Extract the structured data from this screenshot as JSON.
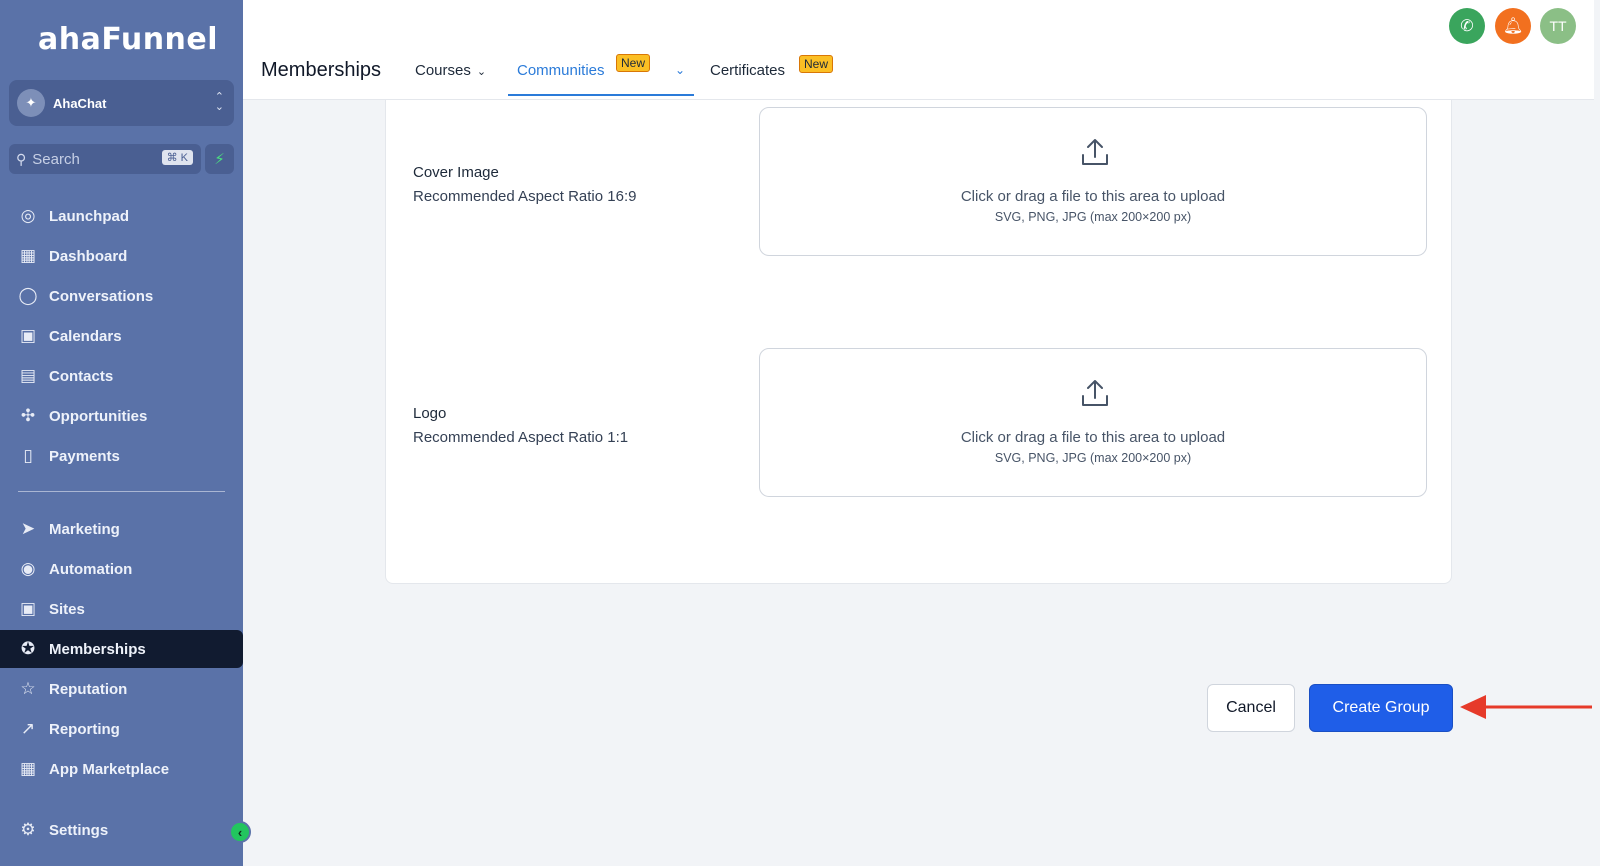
{
  "brand": {
    "logo_text": "ahaFunnel"
  },
  "account": {
    "name": "AhaChat"
  },
  "search": {
    "placeholder": "Search",
    "shortcut": "⌘ K"
  },
  "sidebar": {
    "items": [
      {
        "label": "Launchpad",
        "icon": "rocket-icon"
      },
      {
        "label": "Dashboard",
        "icon": "grid-icon"
      },
      {
        "label": "Conversations",
        "icon": "chat-icon"
      },
      {
        "label": "Calendars",
        "icon": "calendar-icon"
      },
      {
        "label": "Contacts",
        "icon": "contacts-icon"
      },
      {
        "label": "Opportunities",
        "icon": "network-icon"
      },
      {
        "label": "Payments",
        "icon": "receipt-icon"
      },
      {
        "label": "Marketing",
        "icon": "send-icon"
      },
      {
        "label": "Automation",
        "icon": "automation-icon"
      },
      {
        "label": "Sites",
        "icon": "sites-icon"
      },
      {
        "label": "Memberships",
        "icon": "award-icon",
        "active": true
      },
      {
        "label": "Reputation",
        "icon": "star-icon"
      },
      {
        "label": "Reporting",
        "icon": "trend-icon"
      },
      {
        "label": "App Marketplace",
        "icon": "apps-icon"
      },
      {
        "label": "Settings",
        "icon": "gear-icon"
      }
    ]
  },
  "header": {
    "title": "Memberships",
    "tabs": [
      {
        "label": "Courses"
      },
      {
        "label": "Communities",
        "badge": "New",
        "active": true
      },
      {
        "label": "Certificates",
        "badge": "New"
      }
    ],
    "avatar_initials": "TT"
  },
  "form": {
    "cover": {
      "label": "Cover Image",
      "hint": "Recommended Aspect Ratio 16:9",
      "upload_text": "Click or drag a file to this area to upload",
      "upload_hint": "SVG, PNG, JPG (max 200×200 px)"
    },
    "logo": {
      "label": "Logo",
      "hint": "Recommended Aspect Ratio 1:1",
      "upload_text": "Click or drag a file to this area to upload",
      "upload_hint": "SVG, PNG, JPG (max 200×200 px)"
    }
  },
  "actions": {
    "cancel": "Cancel",
    "create": "Create Group"
  },
  "colors": {
    "sidebar_bg": "#5a72a8",
    "active_item_bg": "#111b30",
    "primary": "#1f5ee8",
    "annotation_arrow": "#e63a2a"
  }
}
